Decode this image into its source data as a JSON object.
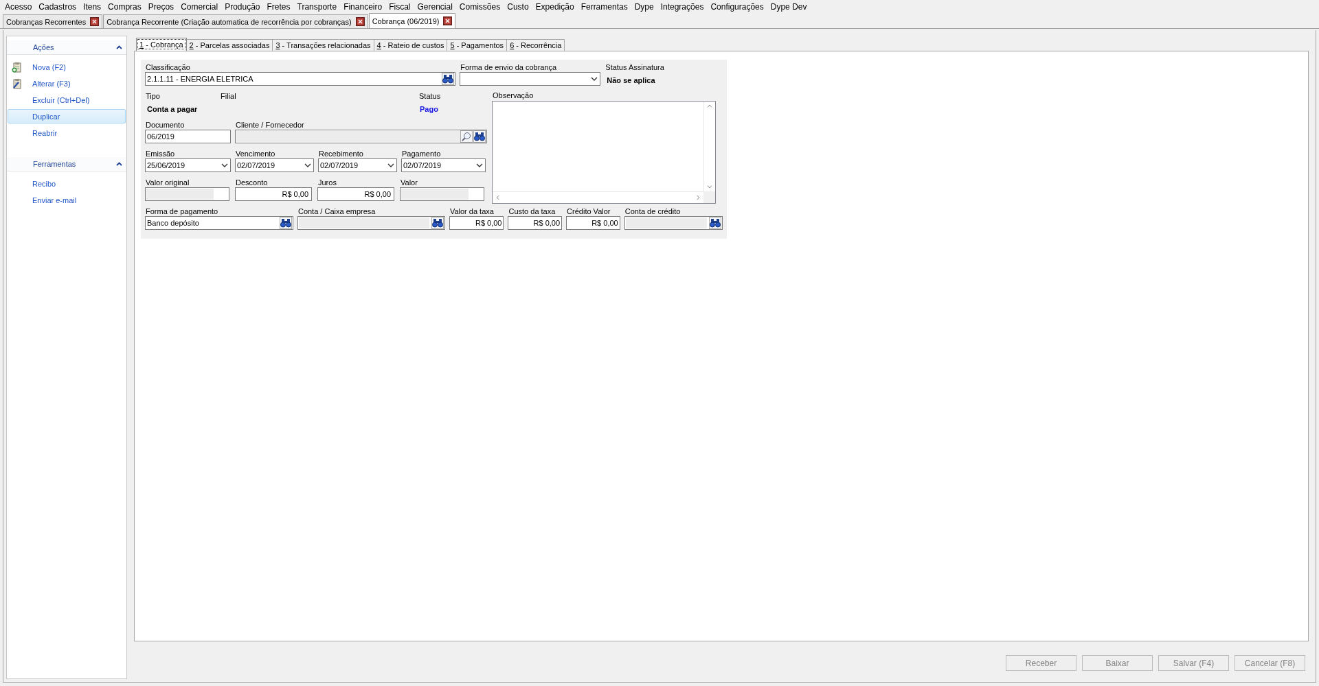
{
  "menu": [
    "Acesso",
    "Cadastros",
    "Itens",
    "Compras",
    "Preços",
    "Comercial",
    "Produção",
    "Fretes",
    "Transporte",
    "Financeiro",
    "Fiscal",
    "Gerencial",
    "Comissões",
    "Custo",
    "Expedição",
    "Ferramentas",
    "Dype",
    "Integrações",
    "Configurações",
    "Dype Dev"
  ],
  "document_tabs": [
    {
      "label": "Cobranças Recorrentes",
      "selected": false
    },
    {
      "label": "Cobrança Recorrente (Criação automatica de recorrência por cobranças)",
      "selected": false
    },
    {
      "label": "Cobrança (06/2019)",
      "selected": true
    }
  ],
  "sidebar": {
    "sections": [
      {
        "title": "Ações",
        "expanded": true,
        "items": [
          {
            "label": "Nova (F2)",
            "kind": "add",
            "selected": false
          },
          {
            "label": "Alterar (F3)",
            "kind": "edit",
            "selected": false
          },
          {
            "label": "Excluir (Ctrl+Del)",
            "kind": "text",
            "selected": false
          },
          {
            "label": "Duplicar",
            "kind": "text",
            "selected": true
          },
          {
            "label": "Reabrir",
            "kind": "text",
            "selected": false
          }
        ]
      },
      {
        "title": "Ferramentas",
        "expanded": true,
        "items": [
          {
            "label": "Recibo",
            "kind": "text",
            "selected": false
          },
          {
            "label": "Enviar e-mail",
            "kind": "text",
            "selected": false
          }
        ]
      }
    ]
  },
  "form_tabs": [
    {
      "label": "1 - Cobrança",
      "selected": true
    },
    {
      "label": "2 - Parcelas associadas",
      "selected": false
    },
    {
      "label": "3 - Transações relacionadas",
      "selected": false
    },
    {
      "label": "4 - Rateio de custos",
      "selected": false
    },
    {
      "label": "5 - Pagamentos",
      "selected": false
    },
    {
      "label": "6 - Recorrência",
      "selected": false
    }
  ],
  "form": {
    "top_row": [
      {
        "label": "Classificação",
        "kind": "lookup",
        "value": "2.1.1.11 - ENERGIA ELETRICA",
        "disabled": false
      },
      {
        "label": "Forma de envio da cobrança",
        "kind": "dropdown",
        "disabled": false
      },
      {
        "label": "Status Assinatura",
        "kind": "static",
        "value": "Não se aplica"
      }
    ],
    "left_rows": [
      [
        {
          "label": "Tipo",
          "kind": "static",
          "value": "Conta a pagar"
        },
        {
          "label": "Filial",
          "kind": "static"
        },
        {
          "label": "Status",
          "kind": "status",
          "value": "Pago"
        }
      ],
      [
        {
          "label": "Documento",
          "kind": "text",
          "value": "06/2019",
          "disabled": false
        },
        {
          "label": "Cliente / Fornecedor",
          "kind": "search-lookup",
          "disabled": true
        }
      ],
      [
        {
          "label": "Emissão",
          "kind": "dropdown",
          "value": "25/06/2019",
          "disabled": false
        },
        {
          "label": "Vencimento",
          "kind": "dropdown",
          "value": "02/07/2019",
          "disabled": false
        },
        {
          "label": "Recebimento",
          "kind": "dropdown",
          "value": "02/07/2019",
          "disabled": false
        },
        {
          "label": "Pagamento",
          "kind": "dropdown",
          "value": "02/07/2019",
          "disabled": false
        }
      ],
      [
        {
          "label": "Valor original",
          "kind": "money",
          "disabled": true
        },
        {
          "label": "Desconto",
          "kind": "money",
          "value": "R$ 0,00",
          "disabled": false
        },
        {
          "label": "Juros",
          "kind": "money",
          "value": "R$ 0,00",
          "disabled": false
        },
        {
          "label": "Valor",
          "kind": "money",
          "disabled": true
        }
      ]
    ],
    "observation": {
      "label": "Observação"
    },
    "bottom_row": [
      {
        "label": "Forma de pagamento",
        "kind": "lookup",
        "value": "Banco depósito",
        "disabled": false
      },
      {
        "label": "Conta / Caixa empresa",
        "kind": "lookup",
        "disabled": true
      },
      {
        "label": "Valor da taxa",
        "kind": "money",
        "value": "R$ 0,00",
        "disabled": false
      },
      {
        "label": "Custo da taxa",
        "kind": "money",
        "value": "R$ 0,00",
        "disabled": false
      },
      {
        "label": "Crédito Valor",
        "kind": "money",
        "value": "R$ 0,00",
        "disabled": false
      },
      {
        "label": "Conta de crédito",
        "kind": "lookup",
        "disabled": true
      }
    ]
  },
  "buttons": [
    {
      "label": "Receber",
      "disabled": true
    },
    {
      "label": "Baixar",
      "disabled": true
    },
    {
      "label": "Salvar (F4)",
      "disabled": true
    },
    {
      "label": "Cancelar (F8)",
      "disabled": true
    }
  ]
}
